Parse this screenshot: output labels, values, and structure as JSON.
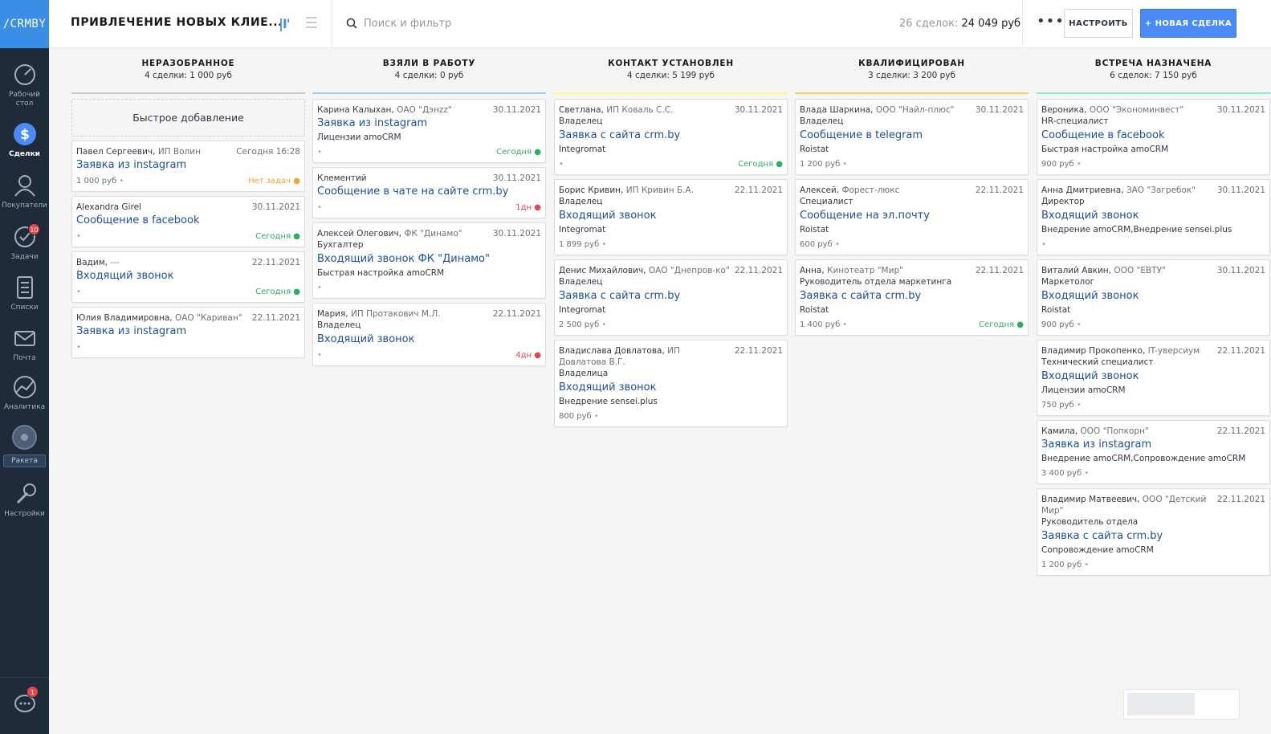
{
  "app": {
    "logo_text": "/CRMBY",
    "colors": {
      "accent": "#4c8bf5",
      "sidebar": "#1f2b3a",
      "logo_bg": "#3a8ee6"
    }
  },
  "sidebar": {
    "items": [
      {
        "label": "Рабочий стол",
        "icon": "dashboard-icon"
      },
      {
        "label": "Сделки",
        "icon": "dollar-icon"
      },
      {
        "label": "Покупатели",
        "icon": "customers-icon"
      },
      {
        "label": "Задачи",
        "icon": "tasks-icon",
        "badge": "10"
      },
      {
        "label": "Списки",
        "icon": "lists-icon"
      },
      {
        "label": "Почта",
        "icon": "mail-icon"
      },
      {
        "label": "Аналитика",
        "icon": "analytics-icon"
      },
      {
        "label": "Ракета",
        "icon": "rocket-icon"
      },
      {
        "label": "Настройки",
        "icon": "settings-icon"
      }
    ],
    "chat_badge": "1"
  },
  "header": {
    "pipeline_title": "ПРИВЛЕЧЕНИЕ НОВЫХ КЛИЕ...",
    "search_placeholder": "Поиск и фильтр",
    "deals_count": "26 сделок:",
    "deals_total": "24 049 руб",
    "more_label": "•••",
    "setup_label": "НАСТРОИТЬ",
    "new_deal_label": "+ НОВАЯ СДЕЛКА"
  },
  "columns": [
    {
      "title": "НЕРАЗОБРАННОЕ",
      "count": "4 сделки:",
      "sum": "1 000 руб",
      "color": "#c7cbd0",
      "quick_add": "Быстрое добавление",
      "cards": [
        {
          "name": "Павел Сергеевич,",
          "company": "ИП Волин",
          "date": "Сегодня 16:28",
          "lead": "Заявка из instagram",
          "price": "1 000 руб",
          "task": "Нет задач",
          "task_kind": "orange"
        },
        {
          "name": "Alexandra Girel",
          "company": "",
          "date": "30.11.2021",
          "lead": "Сообщение в facebook",
          "task": "Сегодня",
          "task_kind": "green"
        },
        {
          "name": "Вадим,",
          "company": "---",
          "date": "22.11.2021",
          "lead": "Входящий звонок",
          "task": "Сегодня",
          "task_kind": "green"
        },
        {
          "name": "Юлия Владимировна,",
          "company": "ОАО \"Кариван\"",
          "date": "22.11.2021",
          "lead": "Заявка из instagram"
        }
      ]
    },
    {
      "title": "ВЗЯЛИ В РАБОТУ",
      "count": "4 сделки:",
      "sum": "0 руб",
      "color": "#99ccff",
      "cards": [
        {
          "name": "Карина Калыхан,",
          "company": "ОАО \"Дэнzz\"",
          "date": "30.11.2021",
          "lead": "Заявка из instagram",
          "tags": "Лицензии amoCRM",
          "task": "Сегодня",
          "task_kind": "green"
        },
        {
          "name": "Клементий",
          "company": "",
          "date": "30.11.2021",
          "lead": "Сообщение в чате на сайте crm.by",
          "task": "1дн",
          "task_kind": "red"
        },
        {
          "name": "Алексей Олегович,",
          "company": "ФК \"Динамо\"",
          "date": "30.11.2021",
          "role": "Бухгалтер",
          "lead": "Входящий звонок ФК \"Динамо\"",
          "tags": "Быстрая настройка amoCRM"
        },
        {
          "name": "Мария,",
          "company": "ИП Протакович М.Л.",
          "date": "22.11.2021",
          "role": "Владелец",
          "lead": "Входящий звонок",
          "task": "4дн",
          "task_kind": "red"
        }
      ]
    },
    {
      "title": "КОНТАКТ УСТАНОВЛЕН",
      "count": "4 сделки:",
      "sum": "5 199 руб",
      "color": "#fffd7f",
      "cards": [
        {
          "name": "Светлана,",
          "company": "ИП Коваль С.С.",
          "date": "30.11.2021",
          "role": "Владелец",
          "lead": "Заявка с сайта crm.by",
          "tags": "Integromat",
          "task": "Сегодня",
          "task_kind": "green"
        },
        {
          "name": "Борис Кривин,",
          "company": "ИП Кривин Б.А.",
          "date": "22.11.2021",
          "role": "Владелец",
          "lead": "Входящий звонок",
          "tags": "Integromat",
          "price": "1 899 руб"
        },
        {
          "name": "Денис Михайлович,",
          "company": "ОАО \"Днепров-ко\"",
          "date": "22.11.2021",
          "role": "Владелец",
          "lead": "Заявка с сайта crm.by",
          "tags": "Integromat",
          "price": "2 500 руб"
        },
        {
          "name": "Владислава Довлатова,",
          "company": "ИП Довлатова В.Г.",
          "date": "22.11.2021",
          "role": "Владелица",
          "lead": "Входящий звонок",
          "tags": "Внедрение sensei.plus",
          "price": "800 руб"
        }
      ]
    },
    {
      "title": "КВАЛИФИЦИРОВАН",
      "count": "3 сделки:",
      "sum": "3 200 руб",
      "color": "#ffce5a",
      "cards": [
        {
          "name": "Влада Шаркина,",
          "company": "ООО \"Найл-плюс\"",
          "date": "30.11.2021",
          "role": "Владелец",
          "lead": "Сообщение в telegram",
          "tags": "Roistat",
          "price": "1 200 руб"
        },
        {
          "name": "Алексей,",
          "company": "Форест-люкс",
          "date": "22.11.2021",
          "role": "Специалист",
          "lead": "Сообщение на эл.почту",
          "tags": "Roistat",
          "price": "600 руб"
        },
        {
          "name": "Анна,",
          "company": "Кинотеатр \"Мир\"",
          "date": "22.11.2021",
          "role": "Руководитель отдела маркетинга",
          "lead": "Заявка с сайта crm.by",
          "tags": "Roistat",
          "price": "1 400 руб",
          "task": "Сегодня",
          "task_kind": "green"
        }
      ]
    },
    {
      "title": "ВСТРЕЧА НАЗНАЧЕНА",
      "count": "6 сделок:",
      "sum": "7 150 руб",
      "color": "#87f2c0",
      "cards": [
        {
          "name": "Вероника,",
          "company": "ООО \"Экономинвест\"",
          "date": "30.11.2021",
          "role": "HR-специалист",
          "lead": "Сообщение в facebook",
          "tags": "Быстрая настройка amoCRM",
          "price": "900 руб"
        },
        {
          "name": "Анна Дмитриевна,",
          "company": "ЗАО \"Загребок\"",
          "date": "30.11.2021",
          "role": "Директор",
          "lead": "Входящий звонок",
          "tags": "Внедрение amoCRM,Внедрение sensei.plus"
        },
        {
          "name": "Виталий Авкин,",
          "company": "ООО \"ЕВТУ\"",
          "date": "30.11.2021",
          "role": "Маркетолог",
          "lead": "Входящий звонок",
          "tags": "Roistat",
          "price": "900 руб"
        },
        {
          "name": "Владимир Прокопенко,",
          "company": "IT-уверсиум",
          "date": "22.11.2021",
          "role": "Технический специалист",
          "lead": "Входящий звонок",
          "tags": "Лицензии amoCRM",
          "price": "750 руб"
        },
        {
          "name": "Камила,",
          "company": "ООО \"Попкорн\"",
          "date": "22.11.2021",
          "lead": "Заявка из instagram",
          "tags": "Внедрение amoCRM,Сопровождение amoCRM",
          "price": "3 400 руб"
        },
        {
          "name": "Владимир Матвеевич,",
          "company": "ООО \"Детский Мир\"",
          "date": "22.11.2021",
          "role": "Руководитель отдела",
          "lead": "Заявка с сайта crm.by",
          "tags": "Сопровождение amoCRM",
          "price": "1 200 руб"
        }
      ]
    }
  ]
}
